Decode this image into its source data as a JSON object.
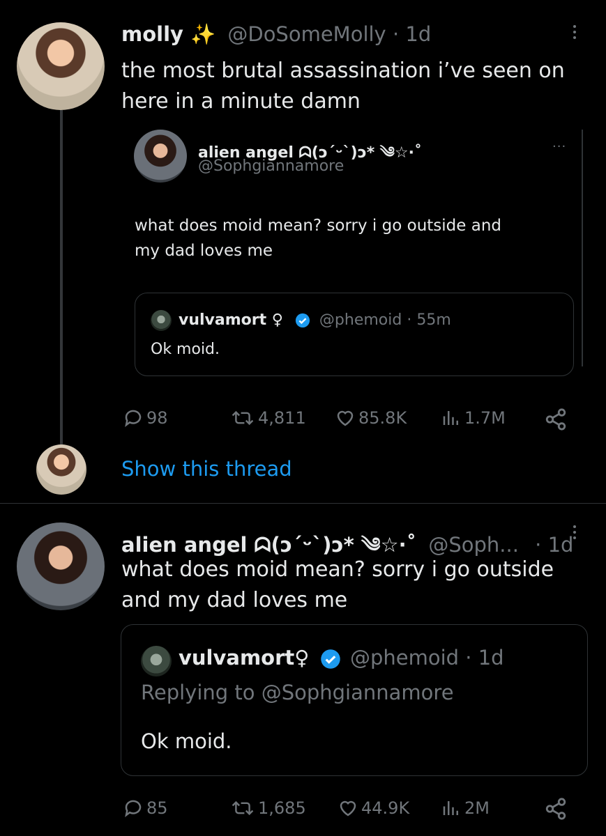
{
  "tweet1": {
    "display_name": "molly ✨",
    "handle": "@DoSomeMolly",
    "time": "· 1d",
    "text_line1": "the most brutal assassination i’ve seen on",
    "text_line2": "here in a minute damn",
    "quote": {
      "display_name": "alien angel ᗣ(ɔ´ᵕ`)ɔ* ༄☆·˚",
      "handle": "@Sophgiannamore",
      "text_line1": "what does moid mean?  sorry i go outside and",
      "text_line2": "my dad loves me",
      "nested": {
        "display_name": "vulvamort ♀",
        "handle": "@phemoid",
        "time": "· 55m",
        "text": "Ok moid."
      }
    },
    "actions": {
      "replies": "98",
      "reposts": "4,811",
      "likes": "85.8K",
      "views": "1.7M"
    },
    "show_thread": "Show this thread"
  },
  "tweet2": {
    "display_name": "alien angel ᗣ(ɔ´ᵕ`)ɔ* ༄☆·˚",
    "handle": "@Soph...",
    "time": "· 1d",
    "text_line1": "what does moid mean?  sorry i go outside",
    "text_line2": "and my dad loves me",
    "quote": {
      "display_name": "vulvamort♀",
      "handle": "@phemoid",
      "time": "· 1d",
      "replying": "Replying to @Sophgiannamore",
      "text": "Ok moid."
    },
    "actions": {
      "replies": "85",
      "reposts": "1,685",
      "likes": "44.9K",
      "views": "2M"
    }
  },
  "colors": {
    "background": "#000000",
    "text": "#e7e9ea",
    "muted": "#71767b",
    "link": "#1d9bf0",
    "border": "#2f3336"
  }
}
